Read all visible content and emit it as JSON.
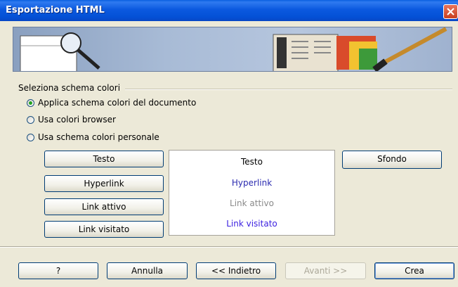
{
  "window": {
    "title": "Esportazione HTML"
  },
  "section": {
    "title": "Seleziona schema colori"
  },
  "radios": [
    {
      "label": "Applica schema colori del documento",
      "checked": true
    },
    {
      "label": "Usa colori browser",
      "checked": false
    },
    {
      "label": "Usa schema colori personale",
      "checked": false
    }
  ],
  "color_buttons": {
    "text": "Testo",
    "hyperlink": "Hyperlink",
    "active_link": "Link attivo",
    "visited_link": "Link visitato",
    "background": "Sfondo"
  },
  "preview": {
    "text": "Testo",
    "hyperlink": "Hyperlink",
    "active_link": "Link attivo",
    "visited_link": "Link visitato"
  },
  "footer": {
    "help": "?",
    "cancel": "Annulla",
    "back": "<< Indietro",
    "next": "Avanti >>",
    "create": "Crea"
  },
  "colors": {
    "preview_text": "#000000",
    "preview_hyperlink": "#2b2bb0",
    "preview_active": "#8a8a8a",
    "preview_visited": "#3a1fe0",
    "titlebar": "#0451d6"
  }
}
